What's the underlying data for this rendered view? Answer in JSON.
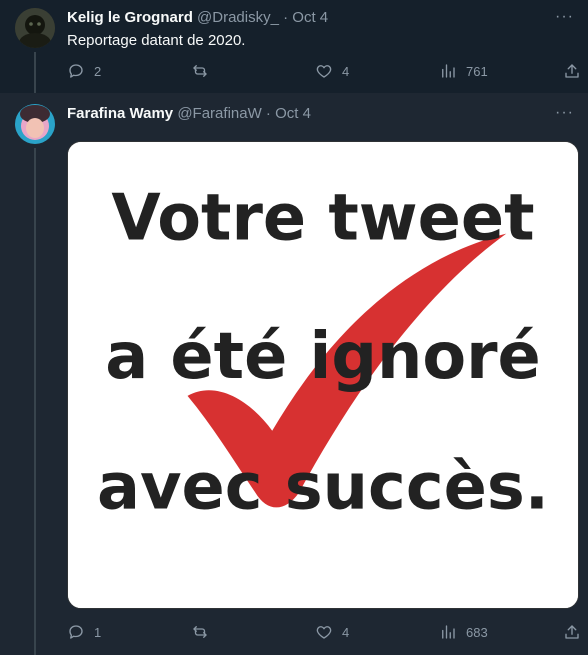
{
  "tweets": [
    {
      "display_name": "Kelig le Grognard",
      "handle": "@Dradisky_",
      "date": "· Oct 4",
      "text": "Reportage datant de 2020.",
      "replies": "2",
      "retweets": "",
      "likes": "4",
      "views": "761"
    },
    {
      "display_name": "Farafina Wamy",
      "handle": "@FarafinaW",
      "date": "· Oct 4",
      "media": {
        "lines": [
          "Votre tweet",
          "a été ignoré",
          "avec succès."
        ]
      },
      "replies": "1",
      "retweets": "",
      "likes": "4",
      "views": "683"
    }
  ],
  "more_label": "···",
  "icons": {
    "reply": "reply-icon",
    "retweet": "retweet-icon",
    "like": "heart-icon",
    "views": "views-icon",
    "share": "share-icon",
    "more": "more-icon"
  },
  "colors": {
    "background": "#15202b",
    "highlight_background": "#1e2732",
    "muted_text": "#8b98a5",
    "checkmark_red": "#d41f1f"
  }
}
